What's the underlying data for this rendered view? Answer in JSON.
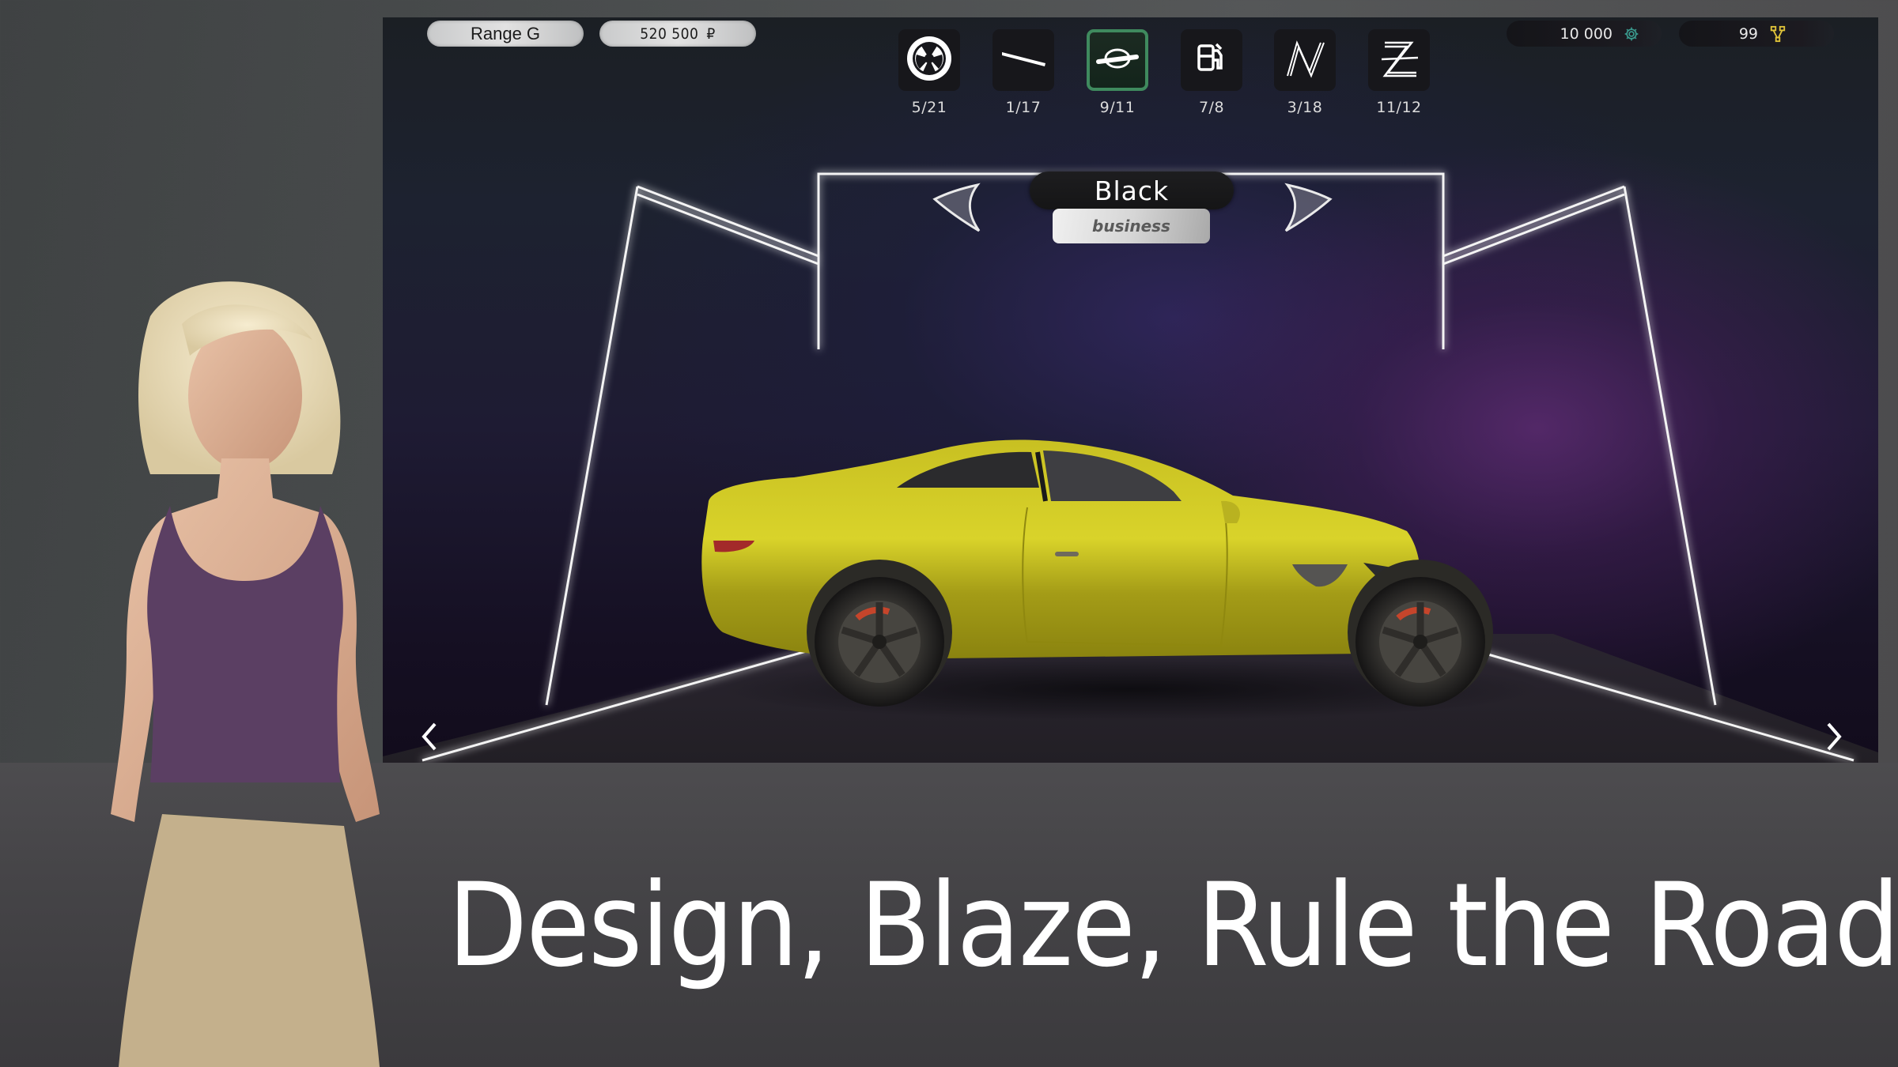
{
  "header": {
    "car_model": "Range G",
    "price": "520 500",
    "price_currency_symbol": "₽",
    "gears_balance": "10 000",
    "gears_icon": "gear-icon",
    "pistons_balance": "99",
    "pistons_icon": "pistons-icon"
  },
  "tabs": [
    {
      "id": "wheels",
      "icon": "wheel-icon",
      "count": "5/21",
      "active": false
    },
    {
      "id": "spoiler",
      "icon": "spoiler-icon",
      "count": "1/17",
      "active": false
    },
    {
      "id": "door-handle",
      "icon": "door-handle-icon",
      "count": "9/11",
      "active": true
    },
    {
      "id": "fuel",
      "icon": "fuel-pump-icon",
      "count": "7/8",
      "active": false
    },
    {
      "id": "decal-n",
      "icon": "decal-n-icon",
      "count": "3/18",
      "active": false
    },
    {
      "id": "decal-z",
      "icon": "decal-z-icon",
      "count": "11/12",
      "active": false
    }
  ],
  "color_selector": {
    "color_name": "Black",
    "color_class": "business",
    "prev_icon": "claw-left-icon",
    "next_icon": "claw-right-icon"
  },
  "navigation": {
    "prev_icon": "chevron-left-icon",
    "next_icon": "chevron-right-icon"
  },
  "tagline": "Design, Blaze, Rule the Road!",
  "colors": {
    "active_tab_border": "#3f8a5e",
    "gear_icon": "#3a9a8e",
    "pistons_icon": "#e0c43a",
    "car_paint": "#c9c21e"
  }
}
